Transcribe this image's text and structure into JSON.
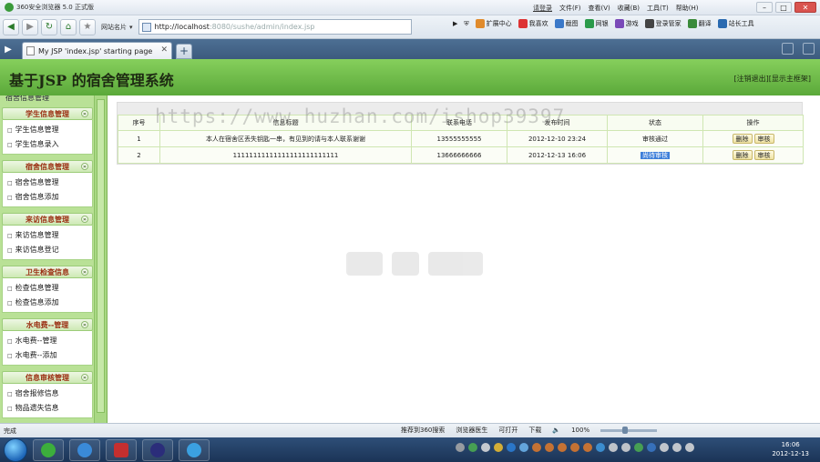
{
  "browser": {
    "title": "360安全浏览器 5.0 正式版",
    "menu": {
      "login": "请登录",
      "file": "文件(F)",
      "view": "查看(V)",
      "favorites": "收藏(B)",
      "tools": "工具(T)",
      "help": "帮助(H)"
    },
    "window_buttons": [
      "–",
      "□",
      "✕"
    ],
    "sites_label": "网站名片",
    "url_host": "http://localhost",
    "url_path": ":8080/sushe/admin/index.jsp",
    "addr_tools": [
      "扩展中心",
      "我喜欢",
      "截图",
      "网银",
      "游戏",
      "登录管家",
      "翻译",
      "站长工具"
    ],
    "tab_title": "My JSP 'index.jsp' starting page",
    "new_tab": "+"
  },
  "page": {
    "title": "基于JSP 的宿舍管理系统",
    "logout": "[注销退出]",
    "home": "[显示主框架]",
    "watermark": "https://www.huzhan.com/ishop39397"
  },
  "sidebar": {
    "clipped_item": "宿舍信息管理",
    "groups": [
      {
        "title": "学生信息管理",
        "items": [
          "学生信息管理",
          "学生信息录入"
        ]
      },
      {
        "title": "宿舍信息管理",
        "items": [
          "宿舍信息管理",
          "宿舍信息添加"
        ]
      },
      {
        "title": "来访信息管理",
        "items": [
          "来访信息管理",
          "来访信息登记"
        ]
      },
      {
        "title": "卫生检查信息",
        "items": [
          "检查信息管理",
          "检查信息添加"
        ]
      },
      {
        "title": "水电费--管理",
        "items": [
          "水电费--管理",
          "水电费--添加"
        ]
      },
      {
        "title": "信息审核管理",
        "items": [
          "宿舍报修信息",
          "物品遗失信息"
        ]
      }
    ]
  },
  "table": {
    "headers": [
      "序号",
      "信息标题",
      "联系电话",
      "发布时间",
      "状态",
      "操作"
    ],
    "rows": [
      {
        "id": "1",
        "title": "本人在宿舍区丢失钥匙一串，有见到的请与本人联系谢谢",
        "phone": "13555555555",
        "time": "2012-12-10 23:24",
        "status": "审核通过",
        "delete": "删除",
        "review": "审核"
      },
      {
        "id": "2",
        "title": "11111111111111111111111111",
        "phone": "13666666666",
        "time": "2012-12-13 16:06",
        "status": "尚待审核",
        "delete": "删除",
        "review": "审核"
      }
    ]
  },
  "statusbar": {
    "left": "完成",
    "recommend": "推荐到360搜索",
    "safe": "浏览器医生",
    "open": "可打开",
    "download": "下载",
    "zoom": "100%"
  },
  "taskbar": {
    "time": "16:06",
    "date": "2012-12-13"
  }
}
